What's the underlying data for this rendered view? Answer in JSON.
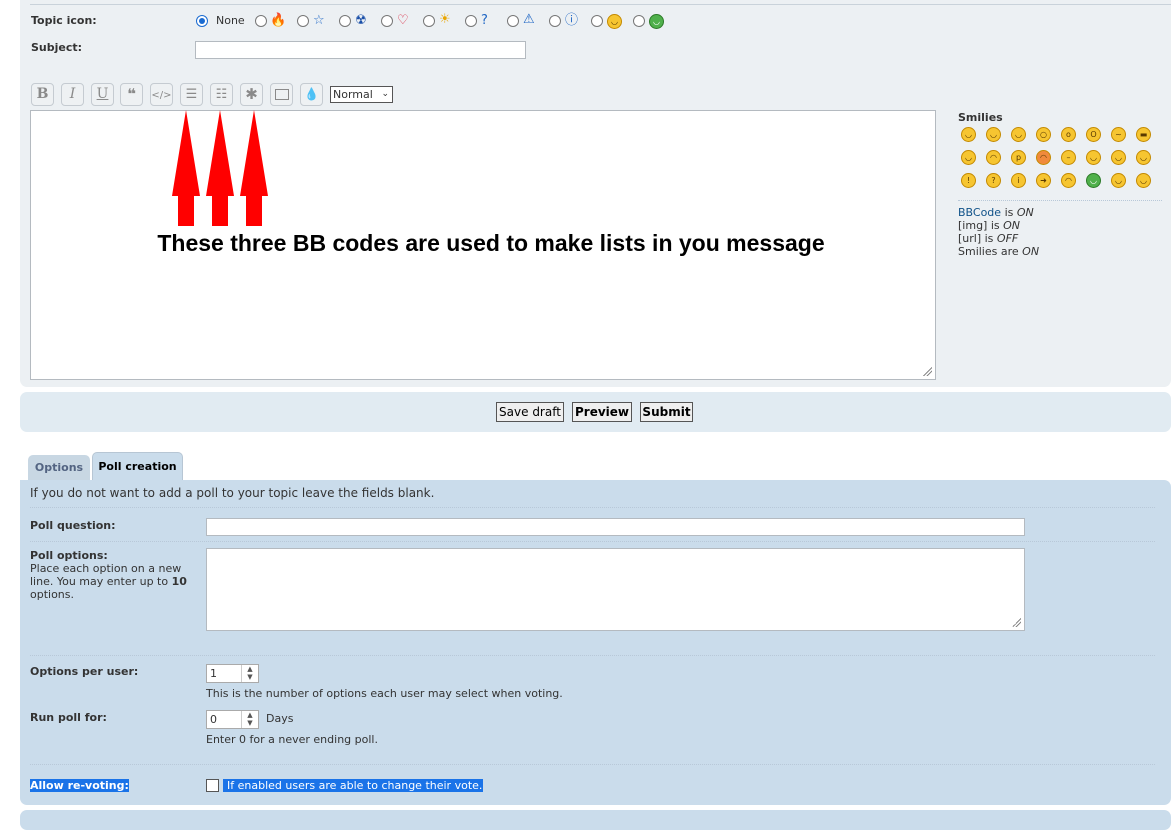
{
  "topic_icon": {
    "label": "Topic icon:",
    "none_label": "None",
    "icons": [
      "fire-icon",
      "star-icon",
      "radioactive-icon",
      "heart-icon",
      "sun-icon",
      "question-icon",
      "warning-icon",
      "info-icon",
      "smiley-icon",
      "grin-icon"
    ]
  },
  "subject": {
    "label": "Subject:",
    "value": ""
  },
  "toolbar": {
    "bold": "B",
    "italic": "I",
    "underline": "U",
    "font_size_value": "Normal"
  },
  "annotation": {
    "text": "These three BB codes are used to make lists in you message"
  },
  "smilies": {
    "title": "Smilies"
  },
  "status": {
    "bbcode_label": "BBCode",
    "bbcode_mid": "is",
    "bbcode_state": "ON",
    "img_label": "[img] is",
    "img_state": "ON",
    "url_label": "[url] is",
    "url_state": "OFF",
    "smilies_label": "Smilies are",
    "smilies_state": "ON"
  },
  "buttons": {
    "save_draft": "Save draft",
    "preview": "Preview",
    "submit": "Submit"
  },
  "tabs": {
    "options": "Options",
    "poll_creation": "Poll creation"
  },
  "poll": {
    "intro": "If you do not want to add a poll to your topic leave the fields blank.",
    "question_label": "Poll question:",
    "options_label": "Poll options:",
    "options_help_1": "Place each option on a new",
    "options_help_2": "line. You may enter up to",
    "options_help_max": "10",
    "options_help_3": "options.",
    "per_user_label": "Options per user:",
    "per_user_value": "1",
    "per_user_help": "This is the number of options each user may select when voting.",
    "run_label": "Run poll for:",
    "run_value": "0",
    "run_unit": "Days",
    "run_help": "Enter 0 for a never ending poll.",
    "revote_label": "Allow re-voting:",
    "revote_help": "If enabled users are able to change their vote."
  }
}
